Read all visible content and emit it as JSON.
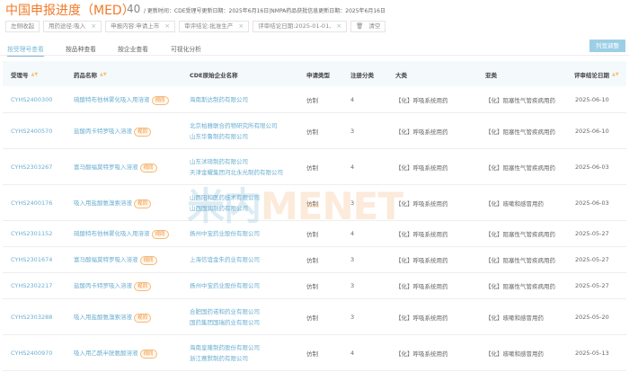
{
  "header": {
    "title": "中国申报进度（MED）",
    "count": "40",
    "update_text": "/ 更新时间：CDE受理号更新日期：2025年6月16日|NMPA药品获批信息更新日期：2025年6月16日"
  },
  "filters": {
    "collapse": "左侧收起",
    "chips": [
      "用药途径:吸入",
      "申报内容:申请上市",
      "审评结论:批准生产",
      "评审结论日期:2025-01-01,"
    ],
    "clear": "清空"
  },
  "tabs": [
    "按受理号查看",
    "按品种查看",
    "按企业查看",
    "可视化分析"
  ],
  "column_adjust": "列宽调整",
  "columns": [
    "受理号",
    "药品名称",
    "CDE原始企业名称",
    "申请类型",
    "注册分类",
    "大类",
    "亚类",
    "评审结论日期"
  ],
  "tag_label": "视同",
  "watermark": {
    "cn": "米内",
    "en": "MENET"
  },
  "rows": [
    {
      "id": "CYHS2400300",
      "drug": "硫酸特布他林雾化吸入用溶液",
      "companies": [
        "海南斯达制药有限公司"
      ],
      "type": "仿制",
      "cls": "4",
      "major": "【化】呼吸系统用药",
      "minor": "【化】阻塞性气管疾病用药",
      "date": "2025-06-10"
    },
    {
      "id": "CYHS2400570",
      "drug": "盐酸丙卡特罗吸入溶液",
      "companies": [
        "北京柏雅联合药物研究所有限公司",
        "山东华鲁制药有限公司"
      ],
      "type": "仿制",
      "cls": "3",
      "major": "【化】呼吸系统用药",
      "minor": "【化】阻塞性气管疾病用药",
      "date": "2025-06-10"
    },
    {
      "id": "CYHS2303267",
      "drug": "富马酸福莫特罗吸入溶液",
      "companies": [
        "山东沭琦制药有限公司",
        "天津金耀集团河北永光制药有限公司"
      ],
      "type": "仿制",
      "cls": "4",
      "major": "【化】呼吸系统用药",
      "minor": "【化】阻塞性气管疾病用药",
      "date": "2025-06-03"
    },
    {
      "id": "CYHS2400176",
      "drug": "吸入用盐酸氨溴索溶液",
      "companies": [
        "山西阳和医药技术有限公司",
        "山西国润制药有限公司"
      ],
      "type": "仿制",
      "cls": "3",
      "major": "【化】呼吸系统用药",
      "minor": "【化】咳嗽和感冒用药",
      "date": "2025-06-03"
    },
    {
      "id": "CYHS2301152",
      "drug": "硫酸特布他林雾化吸入用溶液",
      "companies": [
        "扬州中宝药业股份有限公司"
      ],
      "type": "仿制",
      "cls": "4",
      "major": "【化】呼吸系统用药",
      "minor": "【化】阻塞性气管疾病用药",
      "date": "2025-05-27"
    },
    {
      "id": "CYHS2301674",
      "drug": "富马酸福莫特罗吸入溶液",
      "companies": [
        "上海信谊金朱药业有限公司"
      ],
      "type": "仿制",
      "cls": "3",
      "major": "【化】呼吸系统用药",
      "minor": "【化】阻塞性气管疾病用药",
      "date": "2025-05-27"
    },
    {
      "id": "CYHS2302217",
      "drug": "盐酸丙卡特罗吸入溶液",
      "companies": [
        "扬州中宝药业股份有限公司"
      ],
      "type": "仿制",
      "cls": "3",
      "major": "【化】呼吸系统用药",
      "minor": "【化】阻塞性气管疾病用药",
      "date": "2025-05-27"
    },
    {
      "id": "CYHS2303288",
      "drug": "吸入用盐酸氨溴索溶液",
      "companies": [
        "合肥国药诺和药业有限公司",
        "国药集团国瑞药业有限公司"
      ],
      "type": "仿制",
      "cls": "3",
      "major": "【化】呼吸系统用药",
      "minor": "【化】咳嗽和感冒用药",
      "date": "2025-05-20"
    },
    {
      "id": "CYHS2400970",
      "drug": "吸入用乙酰半胱氨酸溶液",
      "companies": [
        "海南皇隆制药股份有限公司",
        "浙江赛默制药有限公司"
      ],
      "type": "仿制",
      "cls": "4",
      "major": "【化】呼吸系统用药",
      "minor": "【化】咳嗽和感冒用药",
      "date": "2025-05-13"
    }
  ]
}
